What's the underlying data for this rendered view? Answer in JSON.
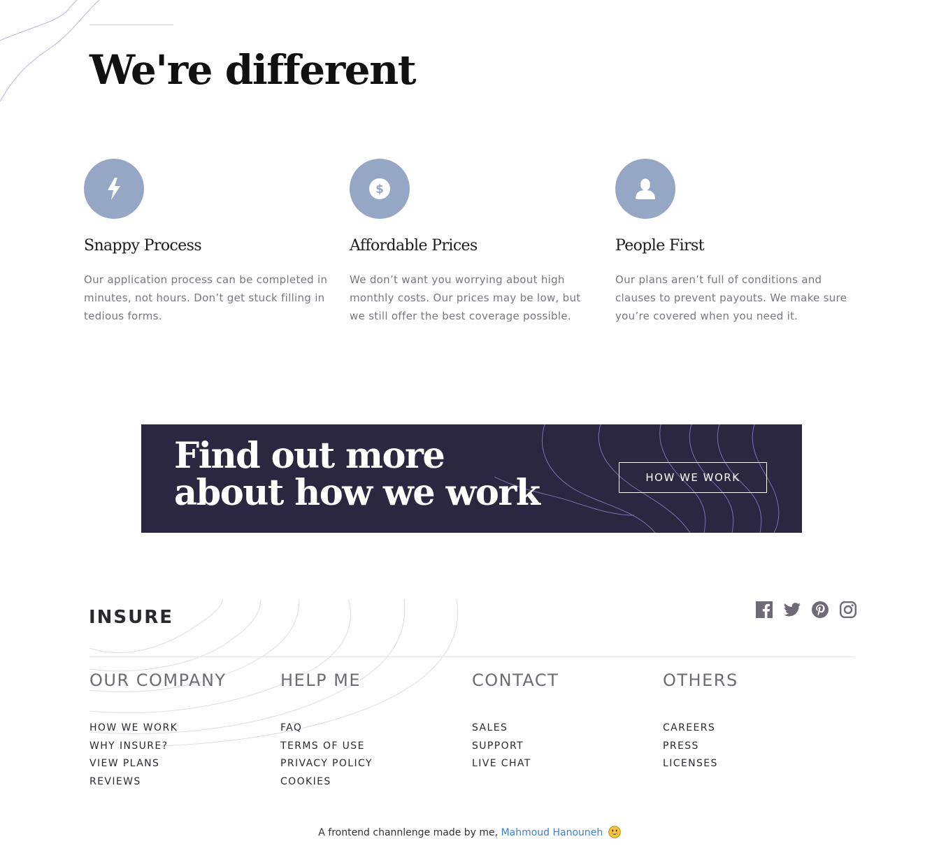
{
  "features": {
    "title": "We're different",
    "items": [
      {
        "icon": "lightning-icon",
        "title": "Snappy Process",
        "text": "Our application process can be completed in minutes, not hours. Don’t get stuck filling in tedious forms."
      },
      {
        "icon": "dollar-coin-icon",
        "title": "Affordable Prices",
        "text": "We don’t want you worrying about high monthly costs. Our prices may be low, but we still offer the best coverage possible."
      },
      {
        "icon": "person-icon",
        "title": "People First",
        "text": "Our plans aren’t full of conditions and clauses to prevent payouts. We make sure you’re covered when you need it."
      }
    ],
    "icon_bg_color": "#96a6c5"
  },
  "banner": {
    "title_line1": "Find out more",
    "title_line2": "about how we work",
    "button_label": "HOW WE WORK",
    "bg_color": "#2c2740"
  },
  "footer": {
    "logo": "INSURE",
    "social": [
      "facebook-icon",
      "twitter-icon",
      "pinterest-icon",
      "instagram-icon"
    ],
    "columns": [
      {
        "heading": "OUR COMPANY",
        "links": [
          "HOW WE WORK",
          "WHY INSURE?",
          "VIEW PLANS",
          "REVIEWS"
        ]
      },
      {
        "heading": "HELP ME",
        "links": [
          "FAQ",
          "TERMS OF USE",
          "PRIVACY POLICY",
          "COOKIES"
        ]
      },
      {
        "heading": "CONTACT",
        "links": [
          "SALES",
          "SUPPORT",
          "LIVE CHAT"
        ]
      },
      {
        "heading": "OTHERS",
        "links": [
          "CAREERS",
          "PRESS",
          "LICENSES"
        ]
      }
    ]
  },
  "attribution": {
    "text": "A frontend channlenge made by me,",
    "author": "Mahmoud Hanouneh",
    "emoji": "grinning-face-icon",
    "link_color": "#3e7fd6"
  }
}
